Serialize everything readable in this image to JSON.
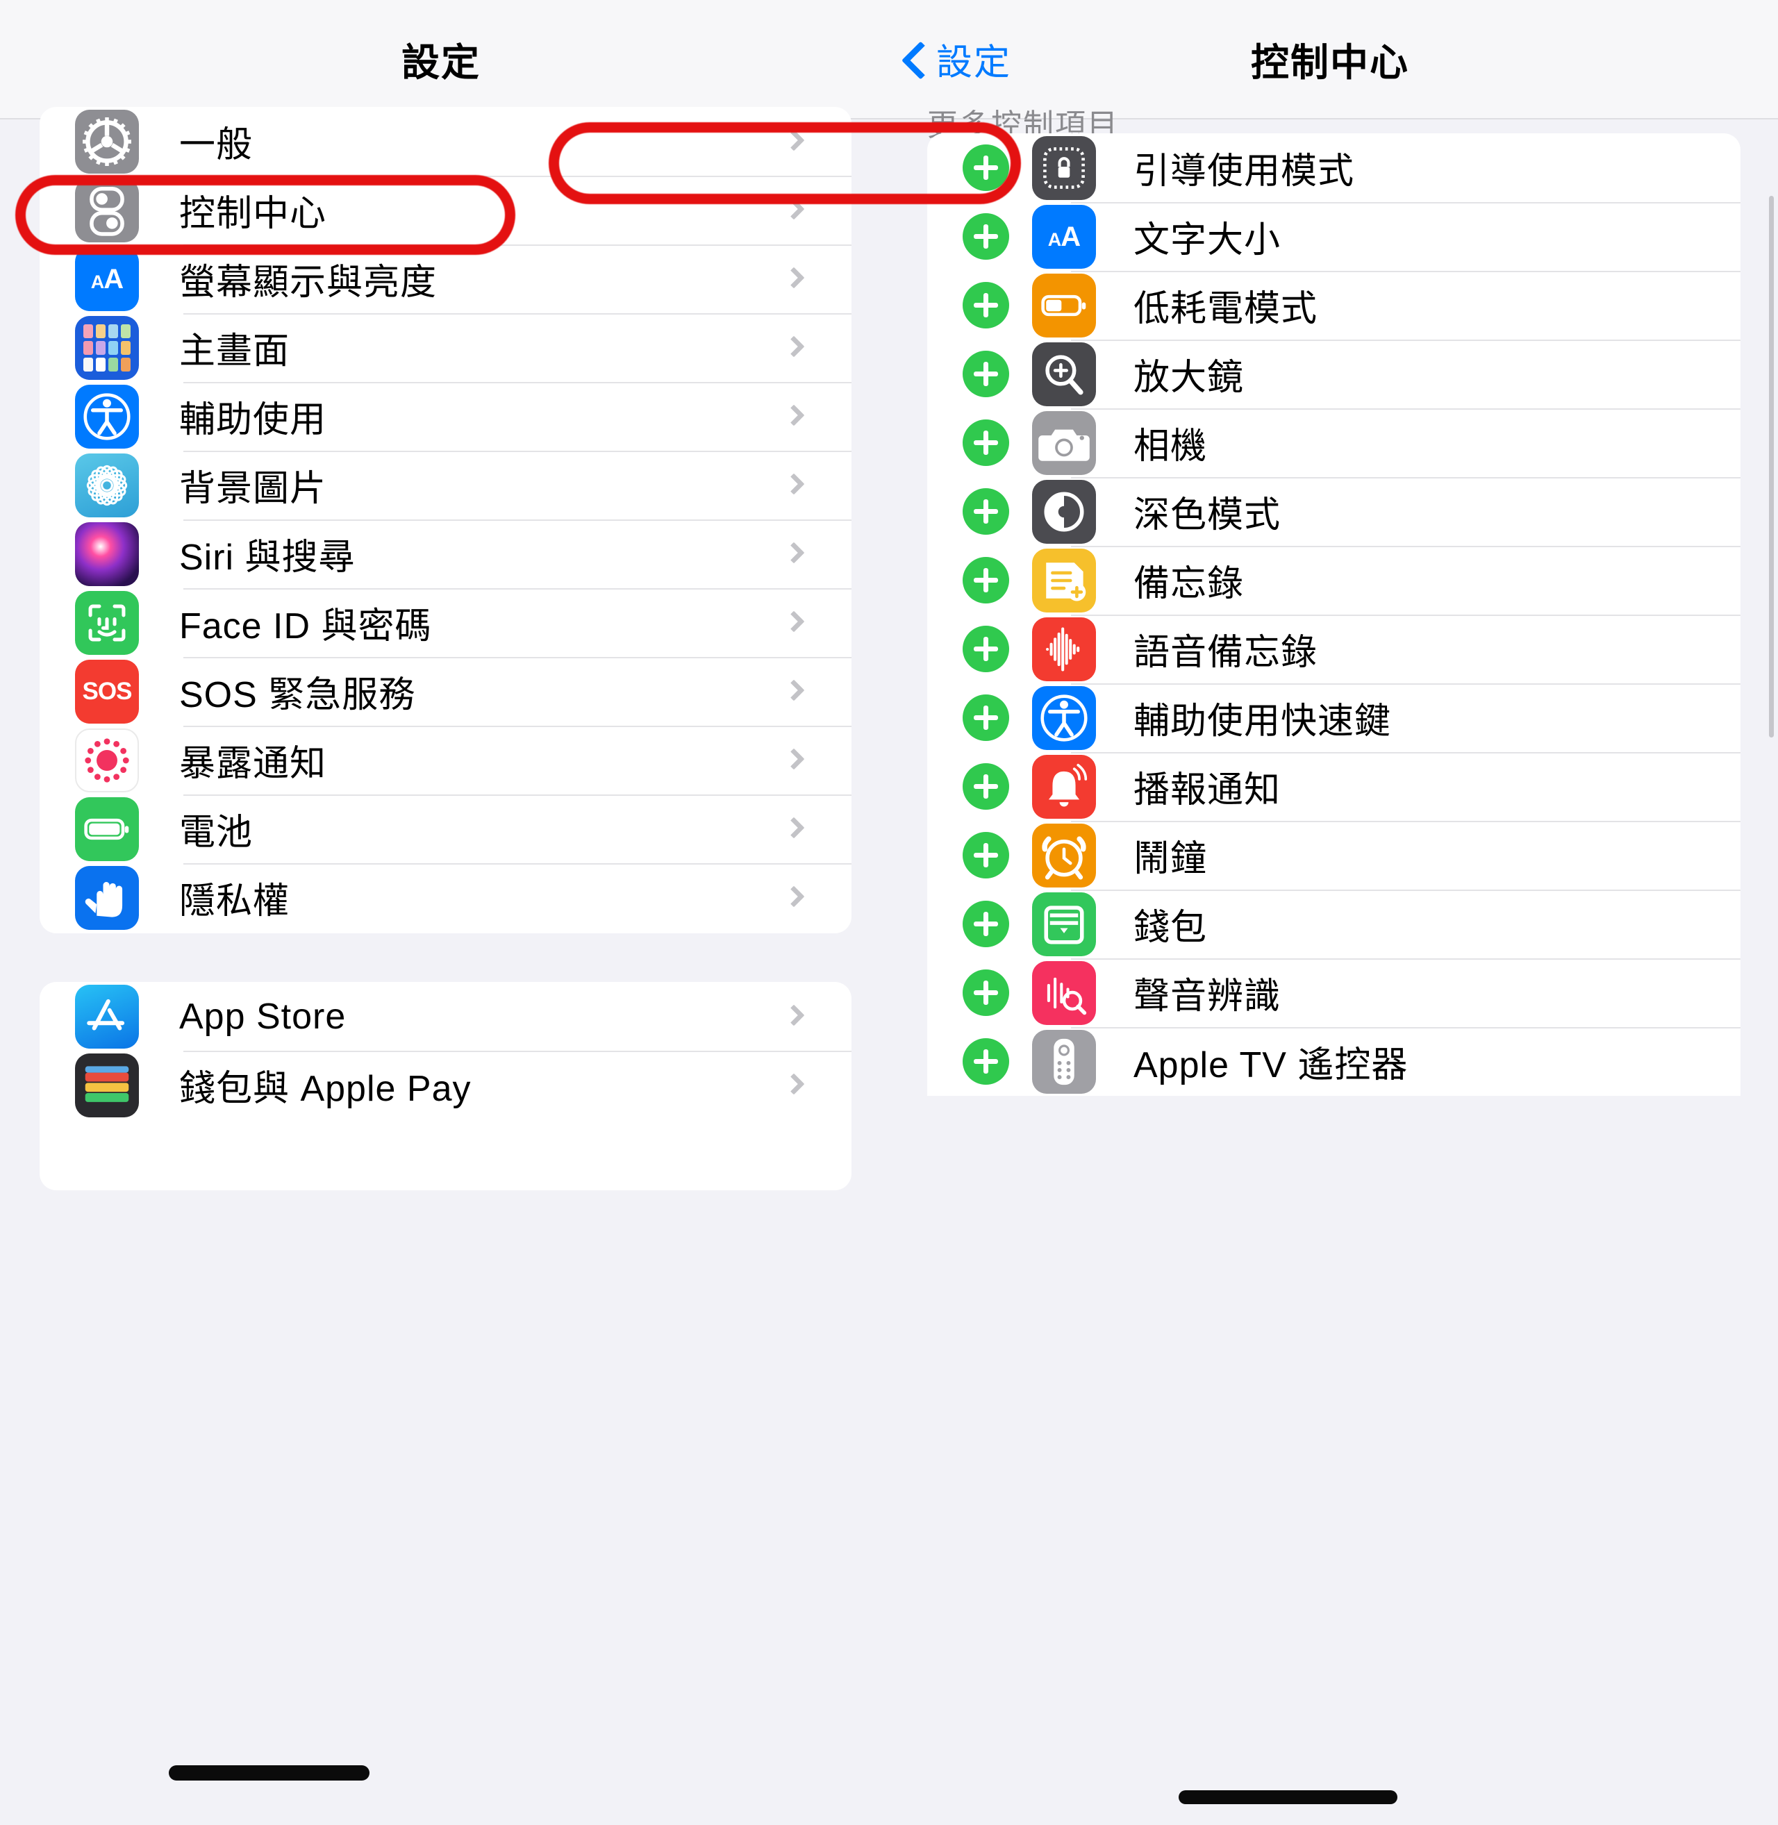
{
  "left_nav": {
    "title": "設定"
  },
  "right_nav": {
    "back_label": "設定",
    "title": "控制中心"
  },
  "sidebar": {
    "group1": [
      {
        "label": "一般",
        "icon": "gear-icon"
      },
      {
        "label": "控制中心",
        "icon": "control-center-icon"
      },
      {
        "label": "螢幕顯示與亮度",
        "icon": "display-brightness-icon"
      },
      {
        "label": "主畫面",
        "icon": "home-screen-icon"
      },
      {
        "label": "輔助使用",
        "icon": "accessibility-icon"
      },
      {
        "label": "背景圖片",
        "icon": "wallpaper-icon"
      },
      {
        "label": "Siri 與搜尋",
        "icon": "siri-icon"
      },
      {
        "label": "Face ID 與密碼",
        "icon": "faceid-icon"
      },
      {
        "label": "SOS 緊急服務",
        "icon": "sos-icon"
      },
      {
        "label": "暴露通知",
        "icon": "exposure-notification-icon"
      },
      {
        "label": "電池",
        "icon": "battery-icon"
      },
      {
        "label": "隱私權",
        "icon": "privacy-icon"
      }
    ],
    "group2": [
      {
        "label": "App Store",
        "icon": "app-store-icon"
      },
      {
        "label": "錢包與 Apple Pay",
        "icon": "wallet-applepay-icon"
      }
    ]
  },
  "control_center": {
    "section_header": "更多控制項目",
    "items": [
      {
        "label": "引導使用模式",
        "icon": "guided-access-icon"
      },
      {
        "label": "文字大小",
        "icon": "text-size-icon"
      },
      {
        "label": "低耗電模式",
        "icon": "low-power-mode-icon"
      },
      {
        "label": "放大鏡",
        "icon": "magnifier-icon"
      },
      {
        "label": "相機",
        "icon": "camera-icon"
      },
      {
        "label": "深色模式",
        "icon": "dark-mode-icon"
      },
      {
        "label": "備忘錄",
        "icon": "notes-icon"
      },
      {
        "label": "語音備忘錄",
        "icon": "voice-memos-icon"
      },
      {
        "label": "輔助使用快速鍵",
        "icon": "accessibility-shortcut-icon"
      },
      {
        "label": "播報通知",
        "icon": "announce-notifications-icon"
      },
      {
        "label": "鬧鐘",
        "icon": "alarm-icon"
      },
      {
        "label": "錢包",
        "icon": "wallet-icon"
      },
      {
        "label": "聲音辨識",
        "icon": "sound-recognition-icon"
      },
      {
        "label": "Apple TV 遙控器",
        "icon": "apple-tv-remote-icon"
      }
    ]
  },
  "annotations": {
    "accent_color": "#e41111",
    "highlighted_sidebar_item": "控制中心",
    "highlighted_control_item": "引導使用模式"
  }
}
